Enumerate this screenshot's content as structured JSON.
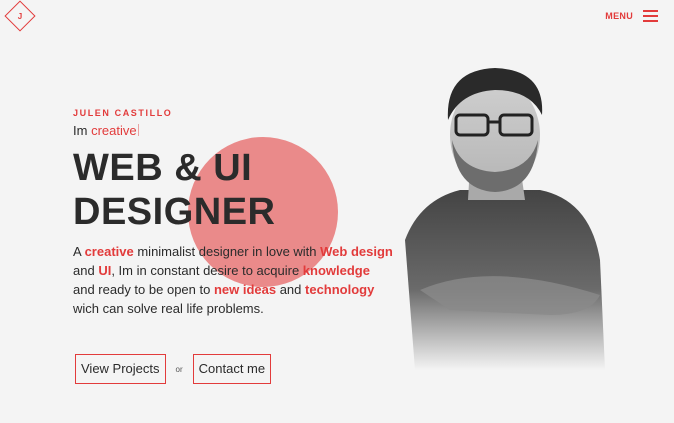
{
  "header": {
    "logo_letter": "J",
    "menu_label": "MENU"
  },
  "hero": {
    "name": "JULEN CASTILLO",
    "tagline_prefix": "Im",
    "tagline_word": "creative",
    "headline_line1": "WEB & UI",
    "headline_line2": "DESIGNER",
    "bio": [
      {
        "text": "A ",
        "hl": false
      },
      {
        "text": "creative",
        "hl": true
      },
      {
        "text": " minimalist designer in love with ",
        "hl": false
      },
      {
        "text": "Web design",
        "hl": true
      },
      {
        "text": " and ",
        "hl": false
      },
      {
        "text": "UI",
        "hl": true
      },
      {
        "text": ", Im in constant desire to acquire ",
        "hl": false
      },
      {
        "text": "knowledge",
        "hl": true
      },
      {
        "text": " and ready to be open to ",
        "hl": false
      },
      {
        "text": "new ideas",
        "hl": true
      },
      {
        "text": " and ",
        "hl": false
      },
      {
        "text": "technology",
        "hl": true
      },
      {
        "text": " wich can solve real life problems.",
        "hl": false
      }
    ]
  },
  "actions": {
    "projects_label": "View Projects",
    "or_label": "or",
    "contact_label": "Contact me"
  },
  "colors": {
    "accent": "#e23b3b",
    "circle": "#ea8a8a",
    "background": "#f4f4f4",
    "text": "#2b2b2b"
  },
  "icons": {
    "logo": "diamond-logo-icon",
    "menu": "hamburger-icon"
  }
}
